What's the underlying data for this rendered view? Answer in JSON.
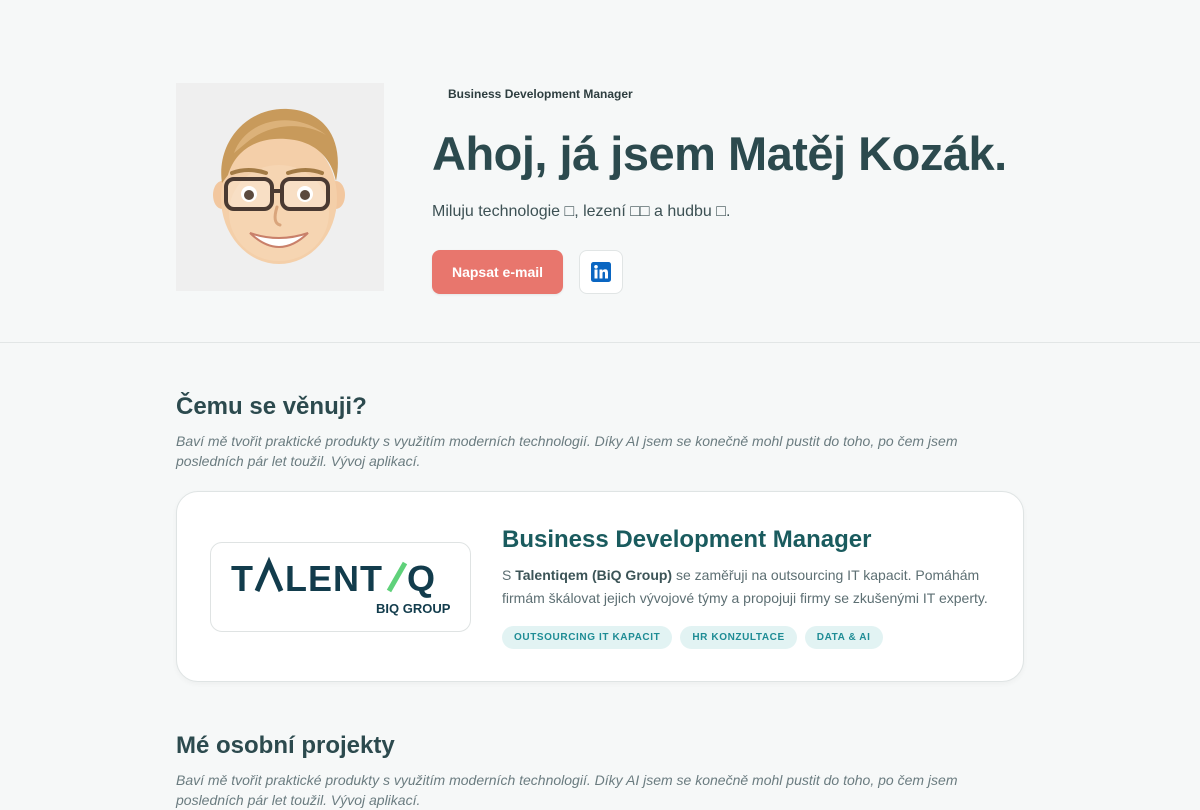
{
  "hero": {
    "tag": "Business Development Manager",
    "title": "Ahoj, já jsem Matěj Kozák.",
    "subtitle": "Miluju technologie □, lezení □□ a hudbu □.",
    "email_button": "Napsat e-mail",
    "linkedin_icon": "linkedin-icon",
    "avatar_icon": "memoji-avatar"
  },
  "focus": {
    "heading": "Čemu se věnuji?",
    "intro": "Baví mě tvořit praktické produkty s využitím moderních technologií. Díky AI jsem se konečně mohl pustit do toho, po čem jsem posledních pár let toužil. Vývoj aplikací.",
    "card": {
      "logo_text": "TALENT/Q",
      "logo_sub": "BIQ GROUP",
      "title": "Business Development Manager",
      "text_prefix": "S ",
      "text_company": "Talentiqem (BiQ Group)",
      "text_suffix": " se zaměřuji na outsourcing IT kapacit. Pomáhám firmám škálovat jejich vývojové týmy a propojuji firmy se zkušenými IT experty.",
      "tags": [
        "OUTSOURCING IT KAPACIT",
        "HR KONZULTACE",
        "DATA & AI"
      ]
    }
  },
  "projects": {
    "heading": "Mé osobní projekty",
    "intro": "Baví mě tvořit praktické produkty s využitím moderních technologií. Díky AI jsem se konečně mohl pustit do toho, po čem jsem posledních pár let toužil. Vývoj aplikací."
  },
  "colors": {
    "accent": "#e8766d",
    "heading": "#2c4a4e",
    "card_title": "#1a5b5e",
    "tag_bg": "#e2f3f3",
    "tag_text": "#1e8c95",
    "linkedin": "#0a66c2"
  }
}
